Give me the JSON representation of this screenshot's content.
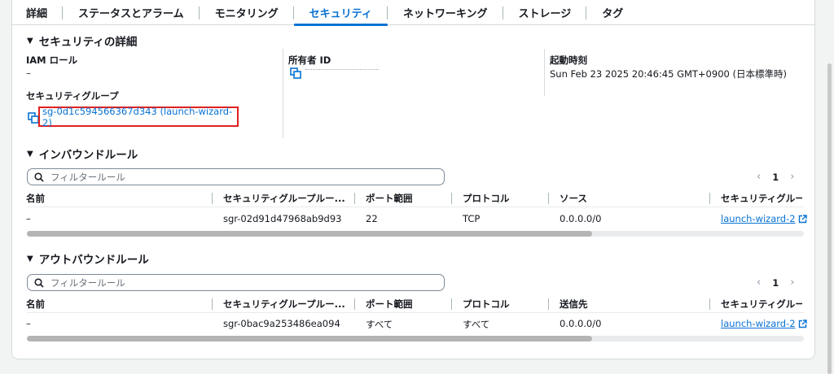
{
  "tabs": [
    {
      "label": "詳細"
    },
    {
      "label": "ステータスとアラーム"
    },
    {
      "label": "モニタリング"
    },
    {
      "label": "セキュリティ"
    },
    {
      "label": "ネットワーキング"
    },
    {
      "label": "ストレージ"
    },
    {
      "label": "タグ"
    }
  ],
  "active_tab": "セキュリティ",
  "security_details": {
    "title": "セキュリティの詳細",
    "iam_role_label": "IAM ロール",
    "iam_role_value": "–",
    "owner_id_label": "所有者 ID",
    "owner_id_value": "",
    "launch_time_label": "起動時刻",
    "launch_time_value": "Sun Feb 23 2025 20:46:45 GMT+0900 (日本標準時)",
    "security_group_label": "セキュリティグループ",
    "security_group_link": "sg-0d1c594566367d343 (launch-wizard-2)"
  },
  "inbound": {
    "title": "インバウンドルール",
    "filter_placeholder": "フィルタールール",
    "page": "1",
    "headers": [
      "名前",
      "セキュリティグループルー...",
      "ポート範囲",
      "プロトコル",
      "ソース",
      "セキュリティグルー"
    ],
    "rows": [
      {
        "name": "–",
        "rule_id": "sgr-02d91d47968ab9d93",
        "port": "22",
        "protocol": "TCP",
        "source": "0.0.0.0/0",
        "sg": "launch-wizard-2"
      }
    ]
  },
  "outbound": {
    "title": "アウトバウンドルール",
    "filter_placeholder": "フィルタールール",
    "page": "1",
    "headers": [
      "名前",
      "セキュリティグループルー...",
      "ポート範囲",
      "プロトコル",
      "送信先",
      "セキュリティグルー"
    ],
    "rows": [
      {
        "name": "–",
        "rule_id": "sgr-0bac9a253486ea094",
        "port": "すべて",
        "protocol": "すべて",
        "destination": "0.0.0.0/0",
        "sg": "launch-wizard-2"
      }
    ]
  },
  "colors": {
    "accent": "#0972d3",
    "highlight_border": "#e02020",
    "text": "#16191f"
  }
}
